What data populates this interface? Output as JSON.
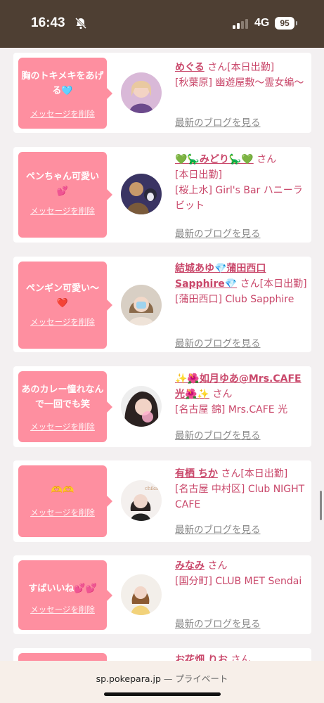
{
  "status_bar": {
    "time": "16:43",
    "network": "4G",
    "battery": "95"
  },
  "cards": [
    {
      "message": "胸のトキメキをあげる🩵",
      "delete_label": "メッセージを削除",
      "name": "めぐる",
      "suffix": "さん[本日出勤]",
      "shop": "[秋葉原] 幽遊屋敷〜霊女編〜",
      "blog_label": "最新のブログを見る"
    },
    {
      "message": "ペンちゃん可愛い💕",
      "delete_label": "メッセージを削除",
      "name": "💚🦕みどり🦕💚",
      "suffix": "さん",
      "status": "[本日出勤]",
      "shop": "[桜上水] Girl's Bar ハニーラビット",
      "blog_label": "最新のブログを見る"
    },
    {
      "message": "ペンギン可愛い〜❤️",
      "delete_label": "メッセージを削除",
      "name": "結城あゆ💎蒲田西口Sapphire💎",
      "suffix": "さん[本日出勤]",
      "shop": "[蒲田西口] Club Sapphire",
      "blog_label": "最新のブログを見る"
    },
    {
      "message": "あのカレー憧れなんで一回でも笑",
      "delete_label": "メッセージを削除",
      "name": "✨🌺如月ゆあ@Mrs.CAFE光🌺✨",
      "suffix": "さん",
      "shop": "[名古屋 錦] Mrs.CAFE 光",
      "blog_label": "最新のブログを見る"
    },
    {
      "message": "🫶🫶",
      "delete_label": "メッセージを削除",
      "name": "有栖 ちか",
      "suffix": "さん[本日出勤]",
      "shop": "[名古屋 中村区] Club NIGHT CAFE",
      "blog_label": "最新のブログを見る"
    },
    {
      "message": "すばいいね💕💕",
      "delete_label": "メッセージを削除",
      "name": "みなみ",
      "suffix": "さん",
      "shop": "[国分町] CLUB MET Sendai",
      "blog_label": "最新のブログを見る"
    },
    {
      "name": "お花畑 りお",
      "suffix": "さん"
    }
  ],
  "browser": {
    "domain": "sp.pokepara.jp",
    "mode": "— プライベート"
  }
}
